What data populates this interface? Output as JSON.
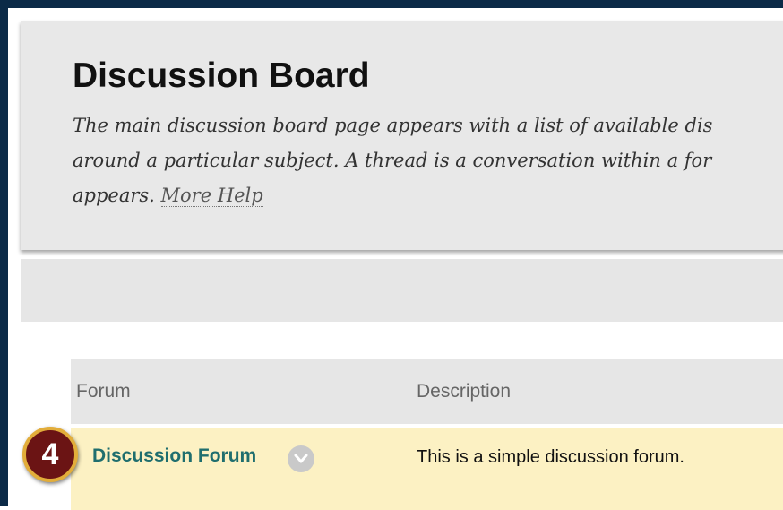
{
  "header": {
    "title": "Discussion Board",
    "description_lines": [
      "The main discussion board page appears with a list of available dis",
      "around a particular subject. A thread is a conversation within a for",
      "appears. "
    ],
    "more_help_label": "More Help"
  },
  "table": {
    "columns": [
      "Forum",
      "Description"
    ],
    "rows": [
      {
        "forum": "Discussion Forum",
        "description": "This is a simple discussion forum."
      }
    ]
  },
  "callout": {
    "step_number": "4"
  },
  "colors": {
    "frame": "#0b2a47",
    "header_bg": "#e8e8e8",
    "row_highlight": "#fcf1c3",
    "link": "#1f6e6e",
    "badge_fill": "#6b1414",
    "badge_ring": "#e2ad3a"
  },
  "icons": {
    "row_menu": "chevron-down-icon"
  }
}
